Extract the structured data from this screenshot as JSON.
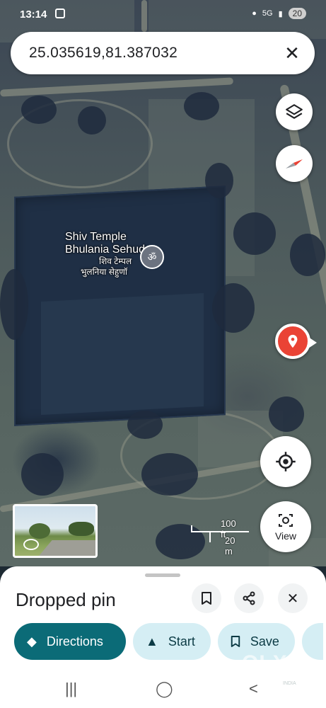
{
  "status_bar": {
    "time": "13:14",
    "network": "5G",
    "battery": "20"
  },
  "search": {
    "query": "25.035619,81.387032",
    "close_icon": "close-icon"
  },
  "map": {
    "place_name_line1": "Shiv Temple",
    "place_name_line2": "Bhulania Sehuda",
    "place_name_hi_line1": "शिव टेम्पल",
    "place_name_hi_line2": "भुलनिया सेहुणॉ",
    "place_icon": "om",
    "scale_ft": "100 ft",
    "scale_m": "20 m",
    "view_label": "View"
  },
  "sheet": {
    "title": "Dropped pin",
    "actions": {
      "directions": "Directions",
      "start": "Start",
      "save": "Save"
    }
  },
  "watermark": {
    "text": "OLX",
    "sub": "INDIA"
  },
  "colors": {
    "primary": "#0b6b77",
    "tonal": "#d5eef4",
    "pin": "#ea4335"
  }
}
